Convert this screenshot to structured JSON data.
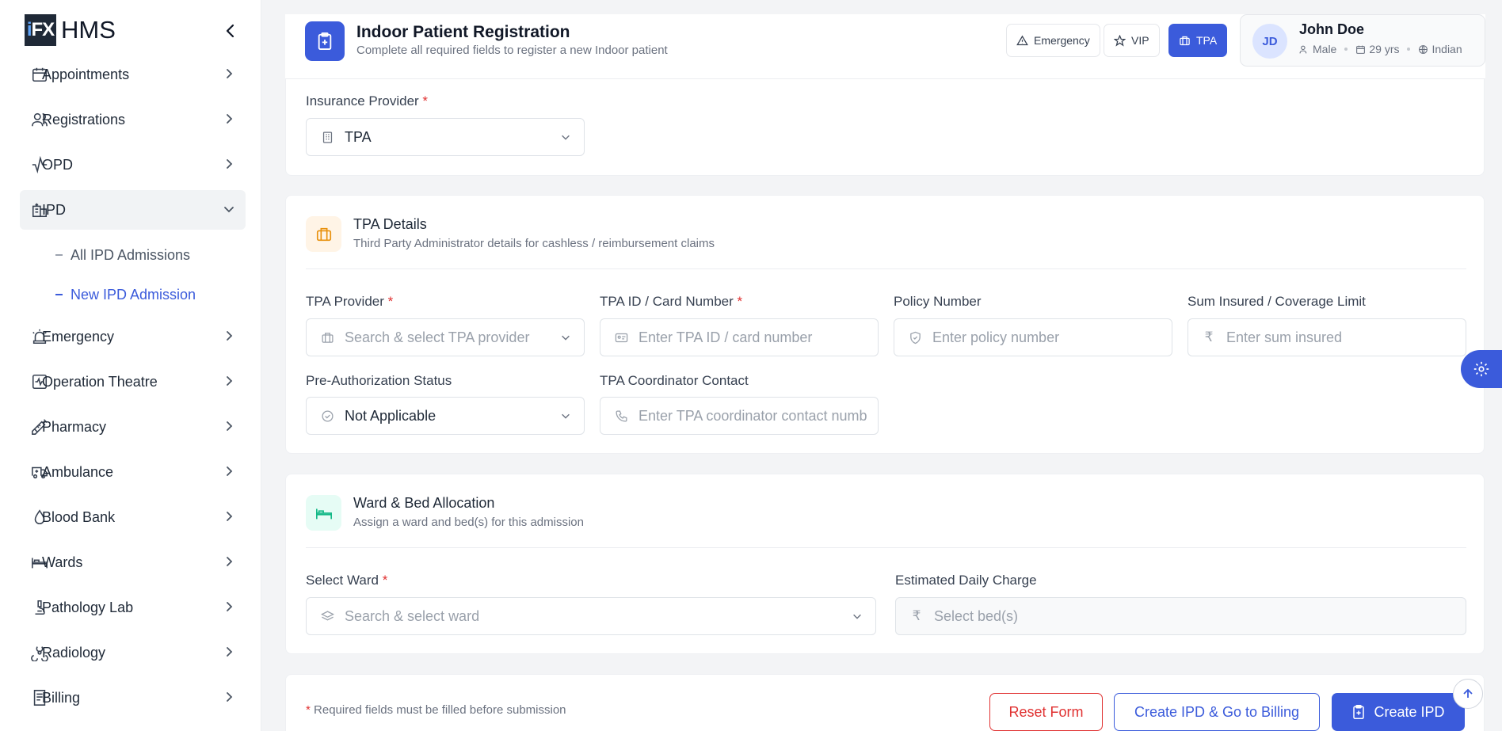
{
  "app": {
    "logo_text": "iFX",
    "name": "HMS"
  },
  "sidebar": {
    "items": [
      {
        "label": "Appointments",
        "icon": "calendar-icon"
      },
      {
        "label": "Registrations",
        "icon": "users-icon"
      },
      {
        "label": "OPD",
        "icon": "activity-icon"
      },
      {
        "label": "IPD",
        "icon": "hospital-icon"
      },
      {
        "label": "Emergency",
        "icon": "siren-icon"
      },
      {
        "label": "Operation Theatre",
        "icon": "monitor-pulse-icon"
      },
      {
        "label": "Pharmacy",
        "icon": "syringe-icon"
      },
      {
        "label": "Ambulance",
        "icon": "ambulance-icon"
      },
      {
        "label": "Blood Bank",
        "icon": "droplet-icon"
      },
      {
        "label": "Wards",
        "icon": "bed-icon"
      },
      {
        "label": "Pathology Lab",
        "icon": "microscope-icon"
      },
      {
        "label": "Radiology",
        "icon": "radiation-icon"
      },
      {
        "label": "Billing",
        "icon": "receipt-icon"
      }
    ],
    "ipd_sub": [
      "All IPD Admissions",
      "New IPD Admission"
    ]
  },
  "header": {
    "title": "Indoor Patient Registration",
    "subtitle": "Complete all required fields to register a new Indoor patient",
    "chips": {
      "emergency": "Emergency",
      "vip": "VIP",
      "tpa": "TPA"
    },
    "patient": {
      "initials": "JD",
      "name": "John Doe",
      "gender": "Male",
      "age": "29 yrs",
      "nationality": "Indian"
    }
  },
  "insurance": {
    "label": "Insurance Provider",
    "value": "TPA"
  },
  "tpa": {
    "title": "TPA Details",
    "subtitle": "Third Party Administrator details for cashless / reimbursement claims",
    "provider_label": "TPA Provider",
    "provider_placeholder": "Search & select TPA provider",
    "id_label": "TPA ID / Card Number",
    "id_placeholder": "Enter TPA ID / card number",
    "policy_label": "Policy Number",
    "policy_placeholder": "Enter policy number",
    "sum_label": "Sum Insured / Coverage Limit",
    "sum_placeholder": "Enter sum insured",
    "preauth_label": "Pre-Authorization Status",
    "preauth_value": "Not Applicable",
    "coordinator_label": "TPA Coordinator Contact",
    "coordinator_placeholder": "Enter TPA coordinator contact numb"
  },
  "ward": {
    "title": "Ward & Bed Allocation",
    "subtitle": "Assign a ward and bed(s) for this admission",
    "ward_label": "Select Ward",
    "ward_placeholder": "Search & select ward",
    "charge_label": "Estimated Daily Charge",
    "charge_placeholder": "Select bed(s)"
  },
  "footer": {
    "note": "Required fields must be filled before submission",
    "required_mark": "*",
    "reset": "Reset Form",
    "billing": "Create IPD & Go to Billing",
    "create": "Create IPD"
  },
  "colors": {
    "primary": "#3b5bdb",
    "danger": "#e03131",
    "tpa_accent": "#fff4e6",
    "ward_accent": "#e6fcf5"
  }
}
